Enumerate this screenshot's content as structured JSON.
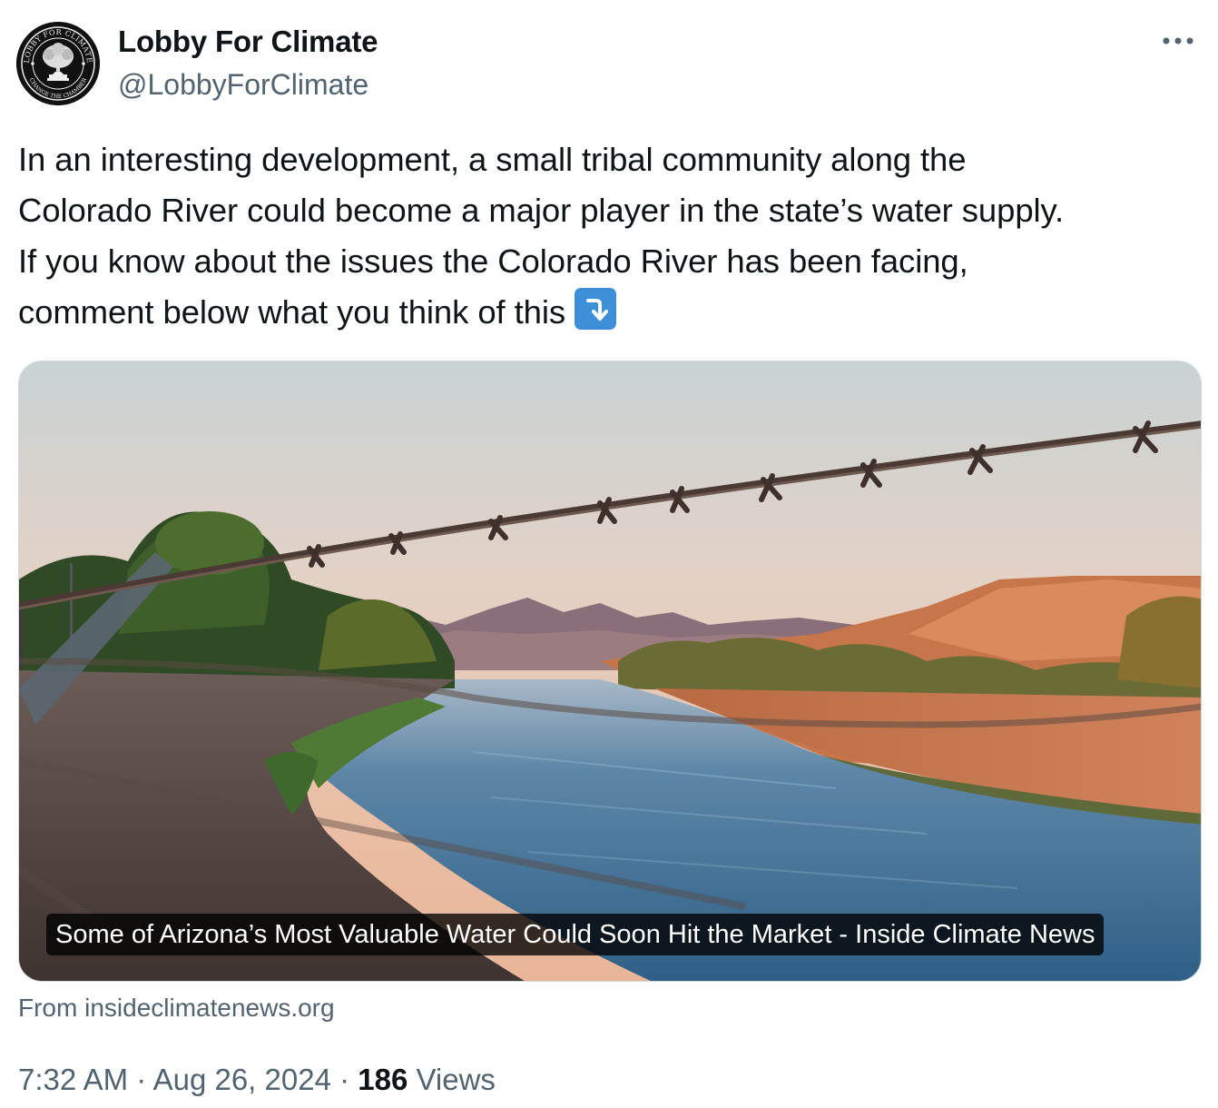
{
  "author": {
    "display_name": "Lobby For Climate",
    "handle": "@LobbyForClimate",
    "avatar_text_top": "LOBBY FOR CLIMATE",
    "avatar_text_bottom": "CHANGE THE CHAMBER"
  },
  "tweet": {
    "text_lines": [
      "In an interesting development, a small tribal community along the",
      "Colorado River could become a major player in the state’s water supply.",
      "If you know about the issues the Colorado River has been facing,",
      "comment below what you think of this"
    ],
    "emoji": "arrow-curving-down-icon"
  },
  "card": {
    "caption": "Some of Arizona’s Most Valuable Water Could Soon Hit the Market - Inside Climate News",
    "source": "From insideclimatenews.org"
  },
  "meta": {
    "time": "7:32 AM",
    "sep1": " · ",
    "date": "Aug 26, 2024",
    "sep2": " · ",
    "views_count": "186",
    "views_label": " Views"
  },
  "icons": {
    "more": "more-horizontal-icon"
  },
  "colors": {
    "text": "#0f1419",
    "secondary": "#536471",
    "border": "#cfd9de",
    "emoji_bg": "#3d8fd8"
  }
}
